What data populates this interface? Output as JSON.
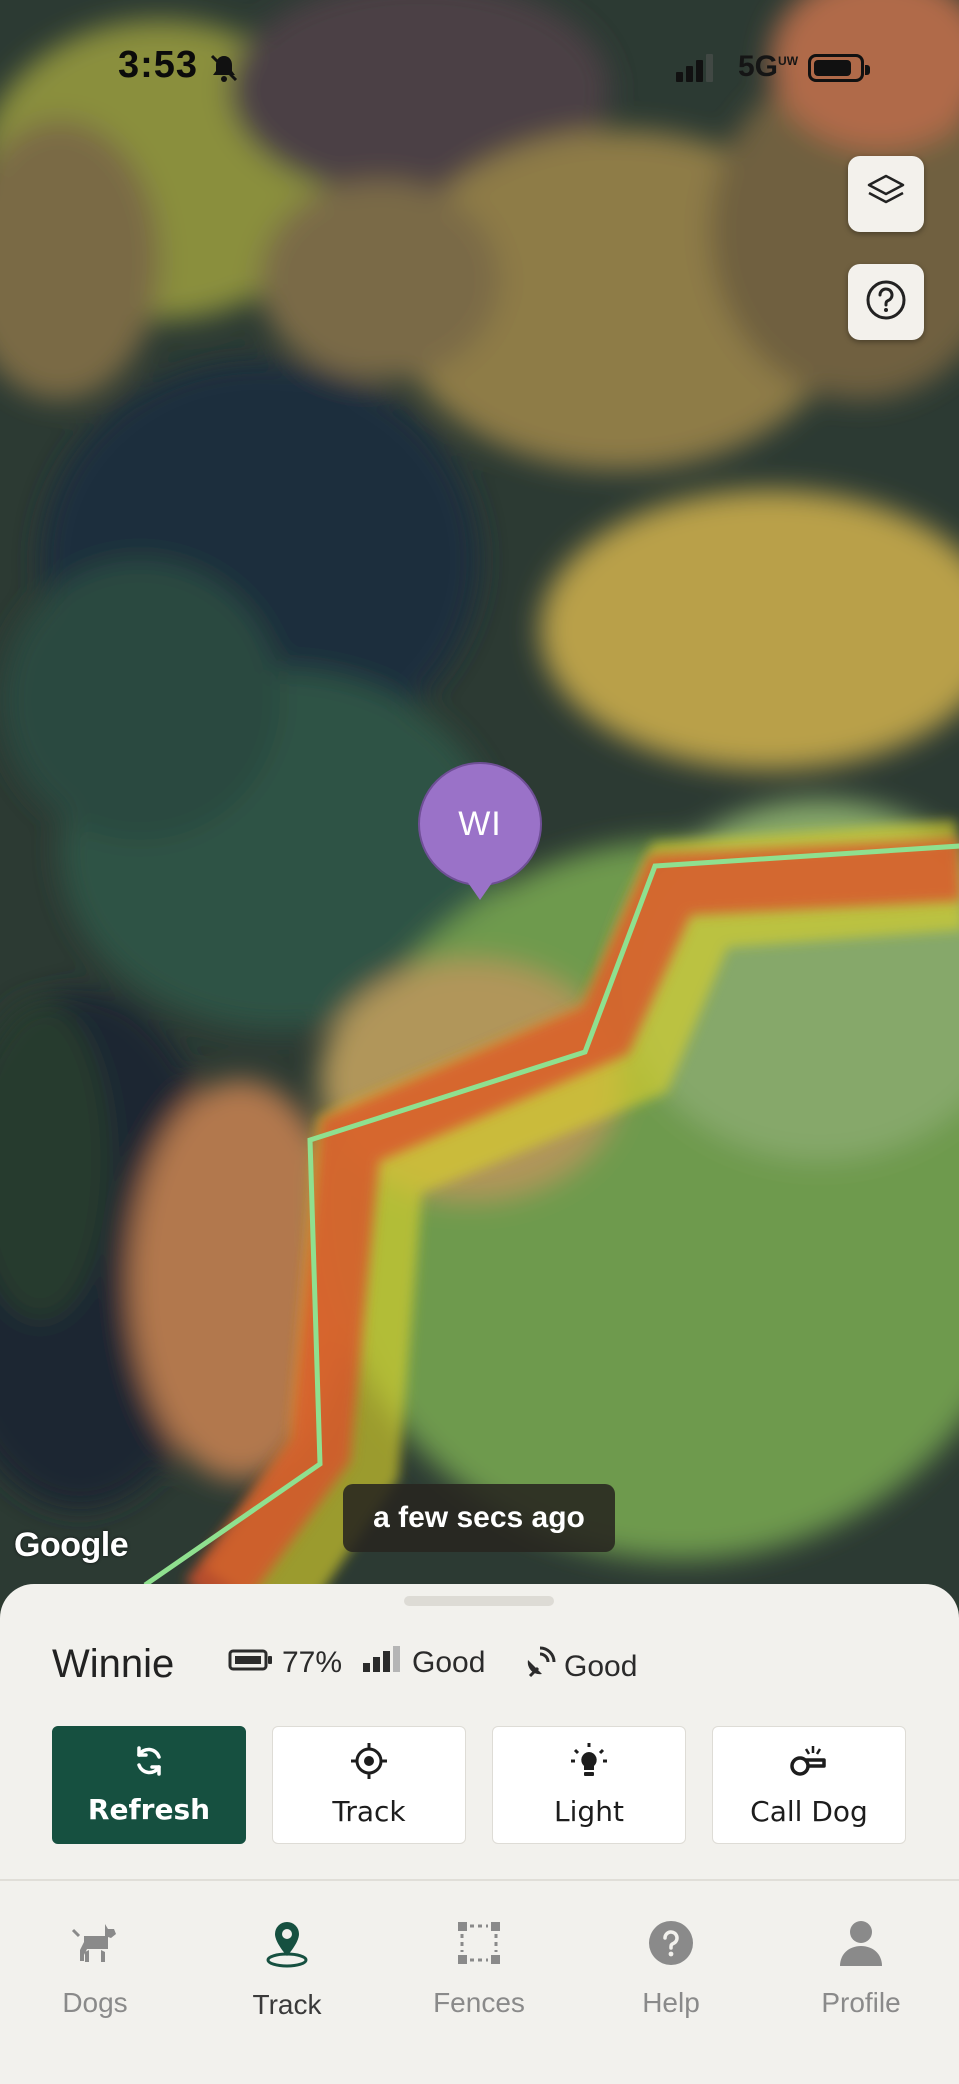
{
  "status_bar": {
    "time": "3:53",
    "network": "5G",
    "network_suffix": "UW",
    "battery_level": 0.85
  },
  "map": {
    "attribution": "Google",
    "marker_label": "WI",
    "last_update": "a few secs ago",
    "colors": {
      "fence_line": "#8fe08f",
      "zone_red": "#d9532b",
      "zone_yellow": "#d7cf2a",
      "marker": "#9a72c8"
    }
  },
  "map_controls": {
    "layers_icon": "layers-icon",
    "help_icon": "question-circle-icon"
  },
  "dog": {
    "name": "Winnie",
    "battery": "77%",
    "signal": "Good",
    "gps": "Good"
  },
  "actions": [
    {
      "label": "Refresh",
      "icon": "refresh-icon"
    },
    {
      "label": "Track",
      "icon": "crosshair-icon"
    },
    {
      "label": "Light",
      "icon": "lightbulb-icon"
    },
    {
      "label": "Call Dog",
      "icon": "whistle-icon"
    }
  ],
  "tabs": [
    {
      "label": "Dogs",
      "icon": "dog-icon"
    },
    {
      "label": "Track",
      "icon": "location-pin-icon",
      "active": true
    },
    {
      "label": "Fences",
      "icon": "fence-icon"
    },
    {
      "label": "Help",
      "icon": "help-icon"
    },
    {
      "label": "Profile",
      "icon": "person-icon"
    }
  ],
  "theme": {
    "primary": "#165040",
    "sheet_background": "#f2f1ed"
  }
}
